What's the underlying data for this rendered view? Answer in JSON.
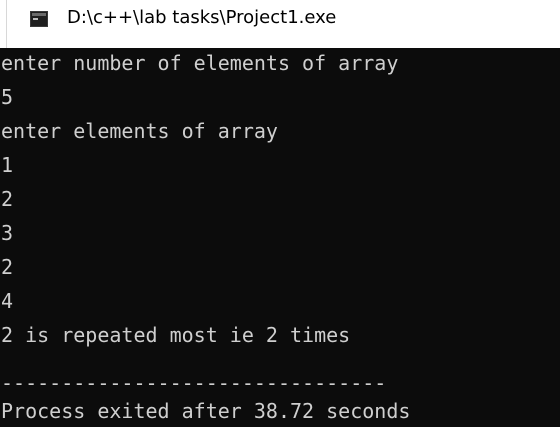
{
  "window": {
    "title": "D:\\c++\\lab tasks\\Project1.exe"
  },
  "console": {
    "lines": [
      "enter number of elements of array",
      "5",
      "enter elements of array",
      "1",
      "2",
      "3",
      "2",
      "4",
      "2 is repeated most ie 2 times",
      "",
      "--------------------------------",
      "Process exited after 38.72 seconds"
    ]
  },
  "colors": {
    "console_background": "#0c0c0c",
    "console_text": "#cfcfcf",
    "titlebar_background": "#ffffff"
  },
  "icons": {
    "app_icon": "console-window-icon"
  }
}
